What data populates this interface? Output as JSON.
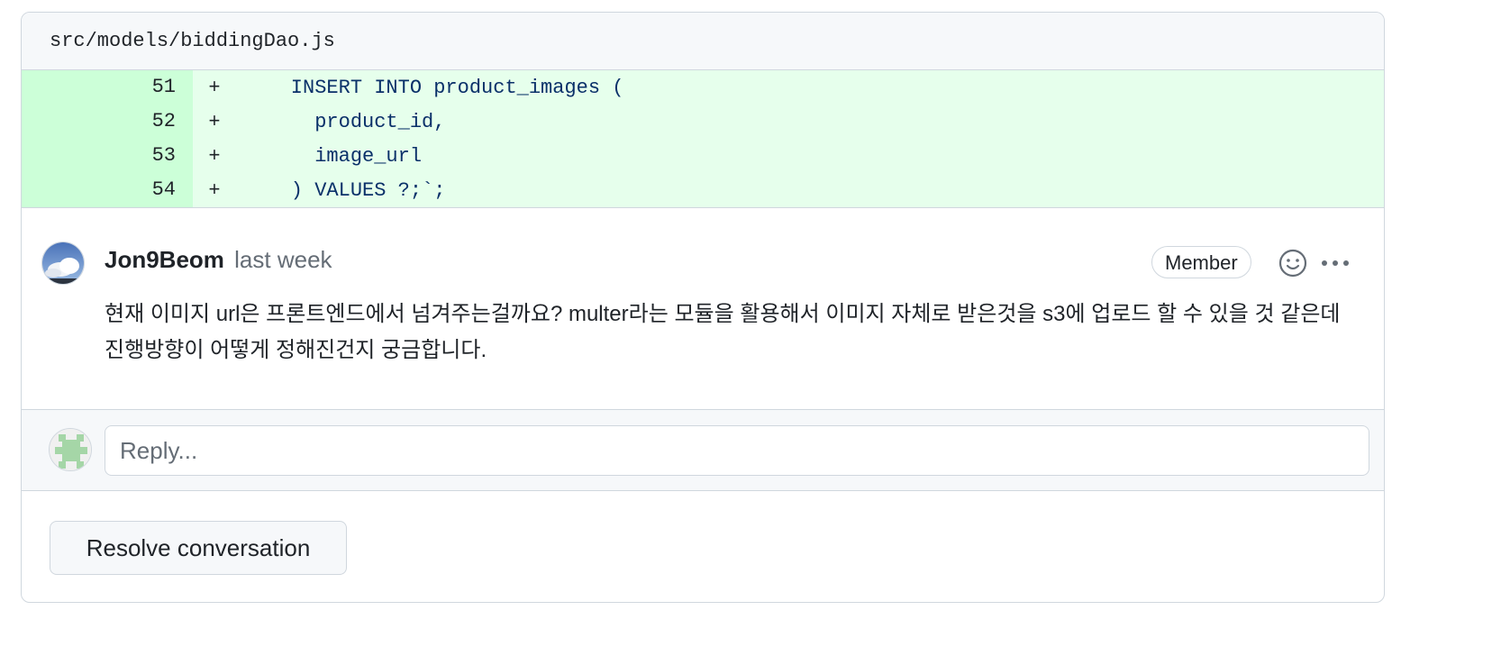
{
  "file": {
    "path": "src/models/biddingDao.js"
  },
  "diff": [
    {
      "line": "51",
      "marker": "+",
      "code": "    INSERT INTO product_images ("
    },
    {
      "line": "52",
      "marker": "+",
      "code": "      product_id,"
    },
    {
      "line": "53",
      "marker": "+",
      "code": "      image_url"
    },
    {
      "line": "54",
      "marker": "+",
      "code": "    ) VALUES ?;`;"
    }
  ],
  "comment": {
    "author": "Jon9Beom",
    "time": "last week",
    "badge": "Member",
    "body": "현재 이미지 url은 프론트엔드에서 넘겨주는걸까요? multer라는 모듈을 활용해서 이미지 자체로 받은것을 s3에 업로드 할 수 있을 것 같은데 진행방향이 어떻게 정해진건지 궁금합니다."
  },
  "reply": {
    "placeholder": "Reply..."
  },
  "actions": {
    "resolve_label": "Resolve conversation"
  },
  "colors": {
    "added_bg": "#e6ffec",
    "added_gutter": "#ccffd8",
    "border": "#d0d7de",
    "muted": "#656d76"
  },
  "icons": [
    "smiley-icon",
    "kebab-horizontal-icon"
  ]
}
